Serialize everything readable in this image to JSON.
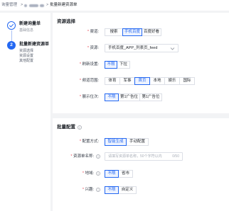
{
  "colors": {
    "primary": "#2468f2",
    "primary_bg": "#eef3fe",
    "text": "#1f2329",
    "muted": "#8a8f99",
    "border": "#dcdfe6",
    "required": "#e64552",
    "page_bg": "#f2f3f5"
  },
  "breadcrumb": {
    "root": "询量管理",
    "separator": ">",
    "current": "批量新建资源单"
  },
  "required_mark": "*",
  "steps": [
    {
      "icon": "check-icon",
      "title": "新建询量单",
      "subtitle": "基础信息"
    },
    {
      "number": "2",
      "title": "批量新建资源单",
      "substeps": [
        "资源选择",
        "资源设置",
        "其他配置"
      ]
    }
  ],
  "resource_section": {
    "title": "资源选择",
    "channel": {
      "label": "渠道:",
      "options": [
        "搜索",
        "手机百度",
        "百度好看"
      ],
      "selected": "手机百度"
    },
    "resource": {
      "label": "资源:",
      "value": "手机百度_APP_列表页_feed",
      "icon": "chevron-down-icon"
    },
    "refresh": {
      "label": "刷新设置:",
      "options": [
        "不限",
        "下拉"
      ],
      "selected": "不限"
    },
    "channel_scope": {
      "label": "频道范围:",
      "options": [
        "体育",
        "军事",
        "首页",
        "本地",
        "娱乐",
        "国际"
      ],
      "selected": "首页"
    },
    "position": {
      "label": "展示位次:",
      "options": [
        "不限",
        "第1广告位",
        "第1广告位"
      ],
      "selected": "不限"
    }
  },
  "batch_section": {
    "title": "批量配置",
    "title_icon": "info-icon",
    "method": {
      "label": "配置方式:",
      "options": [
        "智能生成",
        "手动配置"
      ],
      "selected": "智能生成"
    },
    "name": {
      "label": "资源单名称:",
      "icon": "info-icon",
      "placeholder": "请填写资源单名称，50个字符以内",
      "counter": "0/50"
    },
    "region": {
      "label": "地域:",
      "icon": "info-icon",
      "options": [
        "不限",
        "省市"
      ],
      "selected": "不限"
    },
    "interest": {
      "label": "兴趣:",
      "icon": "info-icon",
      "options": [
        "不限",
        "自定义"
      ],
      "selected": "不限"
    }
  }
}
